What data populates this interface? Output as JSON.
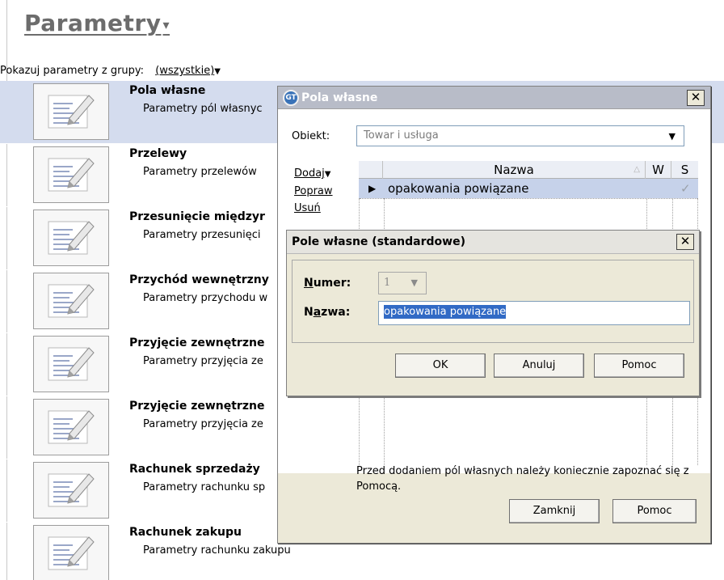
{
  "page": {
    "title": "Parametry",
    "title_caret": "▾",
    "group_filter_label": "Pokazuj parametry z grupy:",
    "group_filter_value": "(wszystkie)",
    "group_filter_caret": "▼"
  },
  "params": [
    {
      "title": "Pola własne",
      "desc": "Parametry pól własnyc",
      "selected": true
    },
    {
      "title": "Przelewy",
      "desc": "Parametry przelewów"
    },
    {
      "title": "Przesunięcie międzyr",
      "desc": "Parametry przesunięci"
    },
    {
      "title": "Przychód wewnętrzny",
      "desc": "Parametry przychodu w"
    },
    {
      "title": "Przyjęcie zewnętrzne",
      "desc": "Parametry przyjęcia ze"
    },
    {
      "title": "Przyjęcie zewnętrzne",
      "desc": "Parametry przyjęcia ze"
    },
    {
      "title": "Rachunek sprzedaży",
      "desc": "Parametry rachunku sp"
    },
    {
      "title": "Rachunek zakupu",
      "desc": "Parametry rachunku zakupu"
    }
  ],
  "dialog": {
    "logo_text": "GT",
    "title": "Pola własne",
    "close": "✕",
    "object_label": "Obiekt:",
    "object_value": "Towar i usługa",
    "object_arrow": "▼",
    "links": {
      "add": "Dodaj",
      "add_caret": "▼",
      "edit": "Popraw",
      "delete": "Usuń"
    },
    "grid": {
      "columns": [
        "Nazwa",
        "W",
        "S"
      ],
      "sort_marker": "△",
      "rows": [
        {
          "indicator": "▶",
          "name": "opakowania powiązane",
          "w": "",
          "s": "✓"
        }
      ]
    },
    "note": "Przed dodaniem pól własnych należy koniecznie zapoznać się z Pomocą.",
    "buttons": {
      "close": "Zamknij",
      "help": "Pomoc"
    }
  },
  "modal": {
    "title": "Pole własne (standardowe)",
    "close": "✕",
    "number_label_u": "N",
    "number_label_rest": "umer:",
    "number_value": "1",
    "number_arrow": "▼",
    "name_label_pre": "N",
    "name_label_u": "a",
    "name_label_rest": "zwa:",
    "name_value": "opakowania powiązane",
    "buttons": {
      "ok": "OK",
      "cancel": "Anuluj",
      "help": "Pomoc"
    }
  },
  "colors": {
    "selected_row": "#d4dcee",
    "dialog_face": "#ece9d8",
    "selection": "#316ac5"
  },
  "icons": {
    "param": "settings-sheet-icon",
    "logo": "gt-logo-icon"
  }
}
